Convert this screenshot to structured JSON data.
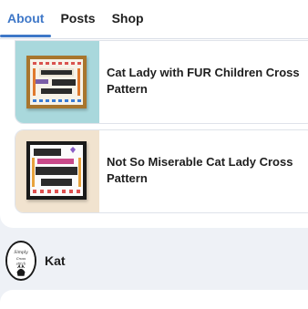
{
  "tabs": [
    {
      "label": "About",
      "active": true
    },
    {
      "label": "Posts",
      "active": false
    },
    {
      "label": "Shop",
      "active": false
    }
  ],
  "products": [
    {
      "title_lines": [
        "Cat Lady with FUR Children Cross",
        "Pattern"
      ],
      "thumb_icon": "cat-lady-fur-children-pattern-thumbnail"
    },
    {
      "title_lines": [
        "Not So Miserable Cat Lady Cross",
        "Pattern"
      ],
      "thumb_icon": "not-so-miserable-cat-lady-pattern-thumbnail"
    }
  ],
  "author": {
    "name": "Kat",
    "avatar_icon": "simply-cross-stitch-logo-avatar"
  },
  "colors": {
    "accent": "#3f78c8",
    "background": "#eef1f6",
    "card": "#ffffff"
  }
}
